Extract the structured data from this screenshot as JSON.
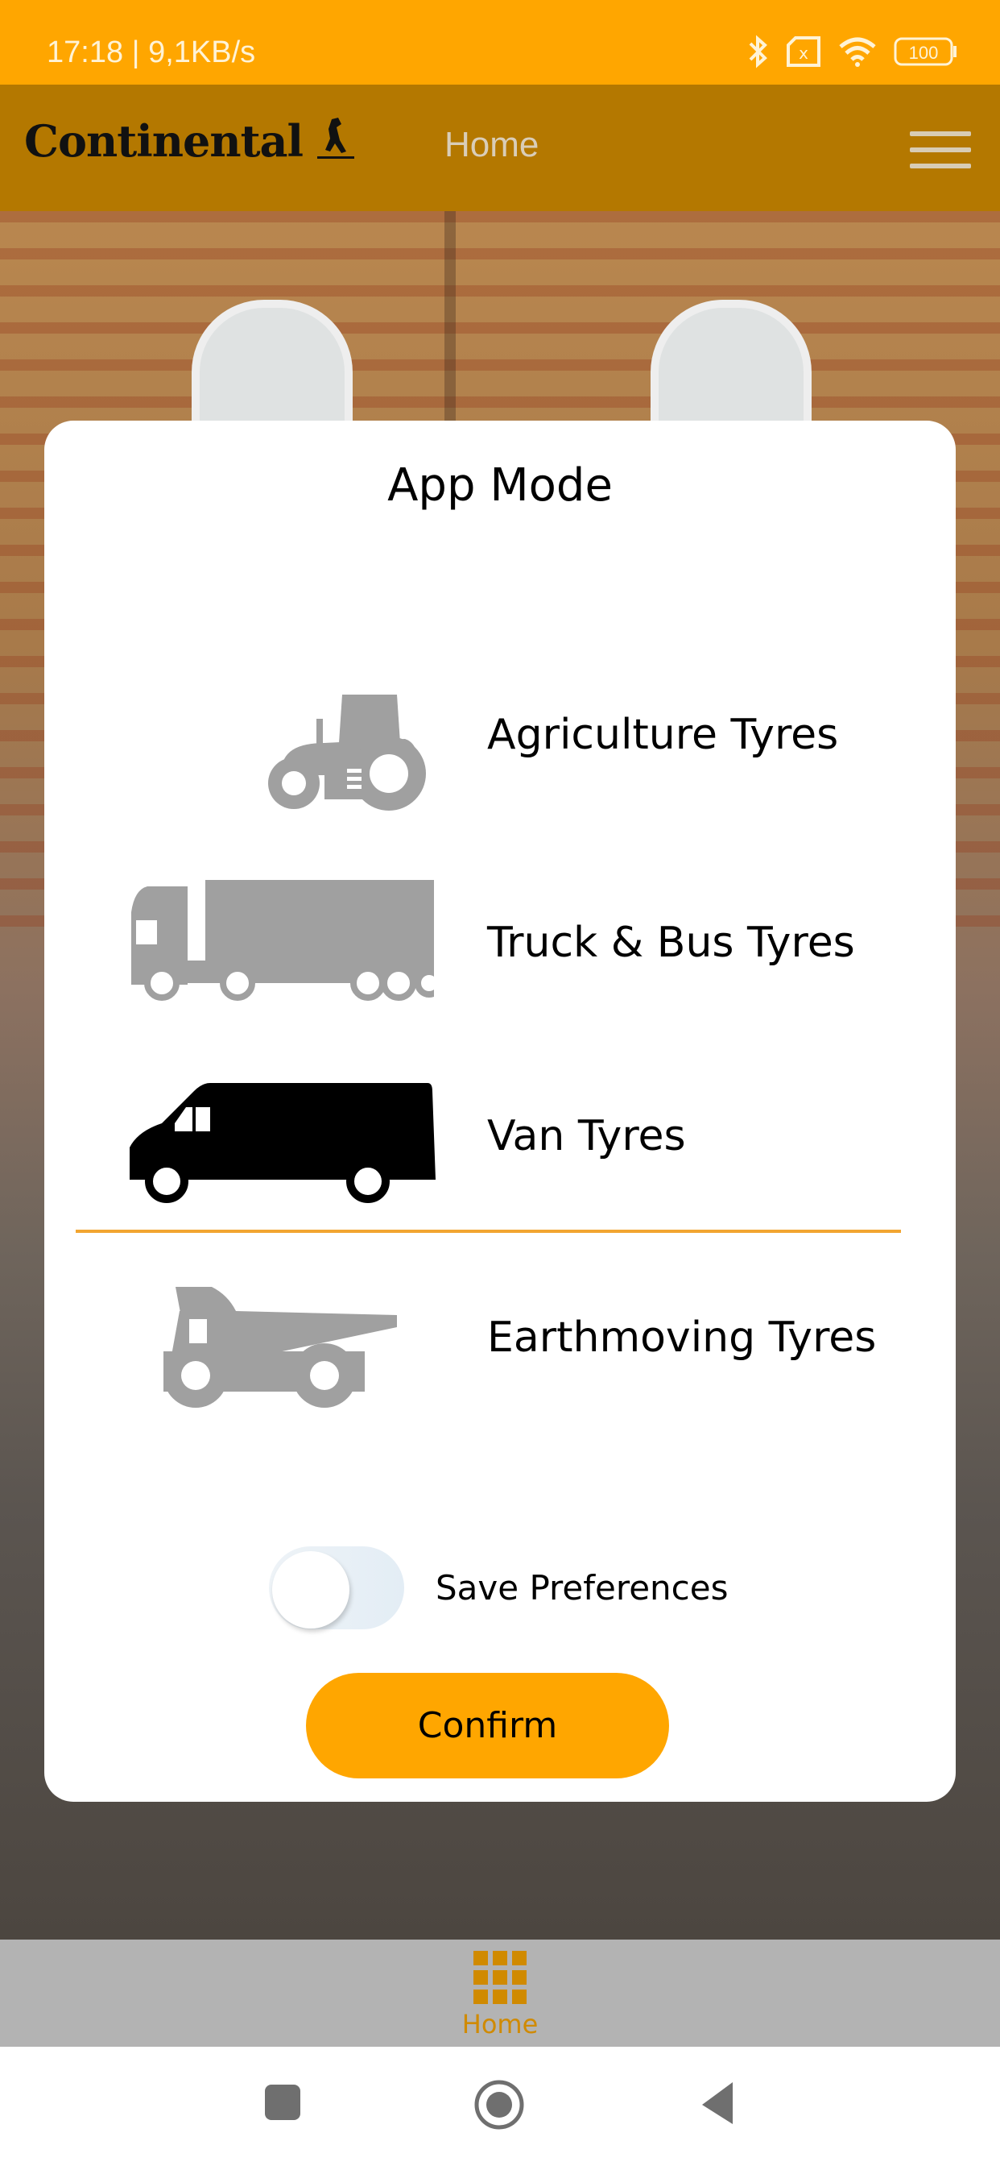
{
  "status_bar": {
    "time_speed": "17:18 | 9,1KB/s",
    "icons": [
      "bluetooth-icon",
      "sim-card-no-signal-icon",
      "wifi-icon",
      "battery-icon"
    ],
    "battery_level": "100"
  },
  "header": {
    "logo_text": "Continental",
    "title": "Home",
    "menu_icon": "hamburger-menu-icon"
  },
  "modal": {
    "title": "App Mode",
    "modes": [
      {
        "label": "Agriculture Tyres",
        "icon": "tractor-icon",
        "selected": false
      },
      {
        "label": "Truck & Bus Tyres",
        "icon": "truck-icon",
        "selected": false
      },
      {
        "label": "Van Tyres",
        "icon": "van-icon",
        "selected": true
      },
      {
        "label": "Earthmoving Tyres",
        "icon": "dump-truck-icon",
        "selected": false
      }
    ],
    "save_preferences_label": "Save Preferences",
    "save_preferences_on": false,
    "confirm_label": "Confirm"
  },
  "bottom_nav": {
    "items": [
      {
        "label": "Home",
        "icon": "grid-icon",
        "active": true
      }
    ]
  },
  "system_nav": [
    "recents-icon",
    "home-icon",
    "back-icon"
  ],
  "colors": {
    "accent": "#FFA600",
    "header_bg": "#B47800",
    "divider": "#F2A531",
    "icon_inactive": "#A0A0A0",
    "icon_active": "#000000",
    "nav_active": "#D08A00"
  }
}
